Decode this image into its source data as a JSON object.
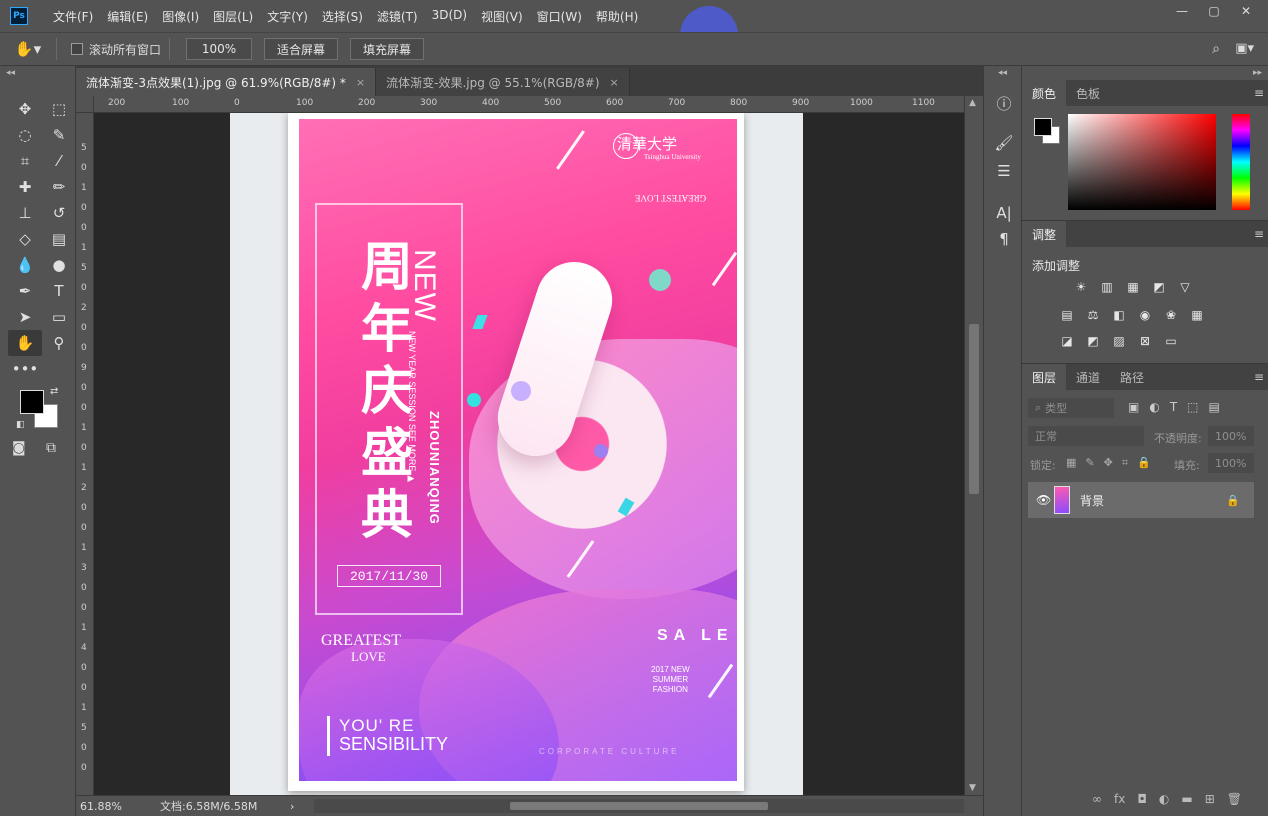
{
  "app": {
    "logo": "Ps"
  },
  "menu": [
    "文件(F)",
    "编辑(E)",
    "图像(I)",
    "图层(L)",
    "文字(Y)",
    "选择(S)",
    "滤镜(T)",
    "3D(D)",
    "视图(V)",
    "窗口(W)",
    "帮助(H)"
  ],
  "window_controls": {
    "minimize": "—",
    "maximize": "▢",
    "close": "✕"
  },
  "options": {
    "scroll_all_label": "滚动所有窗口",
    "zoom_value": "100%",
    "fit_screen": "适合屏幕",
    "fill_screen": "填充屏幕"
  },
  "tabs": [
    {
      "title": "流体渐变-3点效果(1).jpg @ 61.9%(RGB/8#) *",
      "close": "×"
    },
    {
      "title": "流体渐变-效果.jpg @ 55.1%(RGB/8#)",
      "close": "×"
    }
  ],
  "ruler_top": [
    "200",
    "100",
    "0",
    "100",
    "200",
    "300",
    "400",
    "500",
    "600",
    "700",
    "800",
    "900",
    "1000",
    "1100"
  ],
  "ruler_left": [
    "5",
    "0",
    "1",
    "0",
    "0",
    "1",
    "5",
    "0",
    "2",
    "0",
    "0",
    "9",
    "0",
    "0",
    "1",
    "0",
    "1",
    "2",
    "0",
    "0",
    "1",
    "3",
    "0",
    "0",
    "1",
    "4",
    "0",
    "0",
    "1",
    "5",
    "0",
    "0"
  ],
  "poster": {
    "title_chars": [
      "周",
      "年",
      "庆",
      "盛",
      "典"
    ],
    "new": "NEW",
    "new_sub": "NEW YEAR SESSION SEE MORE ▶",
    "zhou": "ZHOUNIANQING",
    "date": "2017/11/30",
    "greatest": "GREATEST",
    "love": "LOVE",
    "youre": "YOU' RE",
    "sensibility": "SENSIBILITY",
    "sale_line1": "SA LE",
    "sale_sub": "2017 NEW\nSUMMER\nFASHION",
    "tsinghua": "清華大学",
    "tsinghua_en": "Tsinghua University",
    "greatest_top": "GREATEST LOVE",
    "corporate": "CORPORATE CULTURE"
  },
  "status": {
    "zoom": "61.88%",
    "doc": "文档:6.58M/6.58M",
    "arrow": "›"
  },
  "panels": {
    "color_tabs": [
      "颜色",
      "色板"
    ],
    "adjust_tab": "调整",
    "adjust_title": "添加调整",
    "layers_tabs": [
      "图层",
      "通道",
      "路径"
    ],
    "kind_placeholder": "类型",
    "blend_mode": "正常",
    "opacity_label": "不透明度:",
    "opacity_value": "100%",
    "lock_label": "锁定:",
    "fill_label": "填充:",
    "fill_value": "100%",
    "layer_name": "背景",
    "menu_glyph": "≡"
  },
  "colors": {
    "foreground": "#000000",
    "background": "#ffffff",
    "cursor_halo": "#4e5cdc"
  }
}
